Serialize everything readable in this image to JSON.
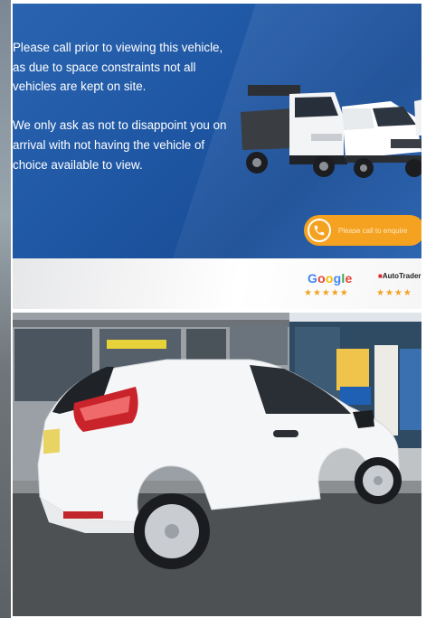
{
  "banner": {
    "paragraph_1": "Please call prior to viewing this vehicle, as due to space constraints not all vehicles are kept on site.",
    "paragraph_2": "We only ask as not to disappoint you on arrival with not having the vehicle of choice available to view.",
    "cta_label": "Please call to enquire",
    "cta_icon": "phone-icon"
  },
  "reviews": {
    "google": {
      "letters": [
        "G",
        "o",
        "o",
        "g",
        "l",
        "e"
      ],
      "colors": [
        "#4285f4",
        "#ea4335",
        "#fbbc05",
        "#4285f4",
        "#34a853",
        "#ea4335"
      ],
      "stars": "★★★★★"
    },
    "autotrader": {
      "brand_prefix": "Auto",
      "brand_suffix": "Trader",
      "stars": "★★★★"
    }
  },
  "photo": {
    "subject": "white-ford-fiesta-van",
    "plate": "?"
  },
  "colors": {
    "banner_blue": "#1e56a3",
    "cta_orange": "#f4a21f",
    "star_gold": "#f3a323"
  }
}
